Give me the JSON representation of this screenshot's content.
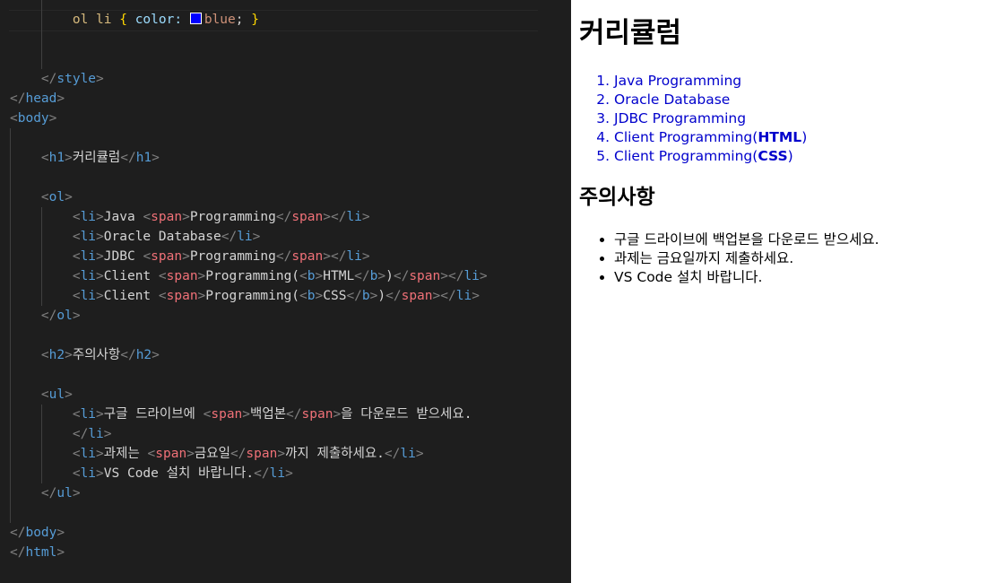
{
  "editor": {
    "lines": [
      [
        [
          "t-text",
          "        "
        ],
        [
          "t-sel",
          "ol li "
        ],
        [
          "t-brace",
          "{ "
        ],
        [
          "t-prop",
          "color: "
        ],
        [
          "swatch",
          ""
        ],
        [
          "t-val",
          "blue"
        ],
        [
          "t-text",
          "; "
        ],
        [
          "t-brace",
          "}"
        ]
      ],
      [],
      [],
      [
        [
          "t-text",
          "    "
        ],
        [
          "t-punc",
          "</"
        ],
        [
          "t-tag",
          "style"
        ],
        [
          "t-punc",
          ">"
        ]
      ],
      [
        [
          "t-punc",
          "</"
        ],
        [
          "t-tag",
          "head"
        ],
        [
          "t-punc",
          ">"
        ]
      ],
      [
        [
          "t-punc",
          "<"
        ],
        [
          "t-tag",
          "body"
        ],
        [
          "t-punc",
          ">"
        ]
      ],
      [],
      [
        [
          "t-text",
          "    "
        ],
        [
          "t-punc",
          "<"
        ],
        [
          "t-tag",
          "h1"
        ],
        [
          "t-punc",
          ">"
        ],
        [
          "t-text",
          "커리큘럼"
        ],
        [
          "t-punc",
          "</"
        ],
        [
          "t-tag",
          "h1"
        ],
        [
          "t-punc",
          ">"
        ]
      ],
      [],
      [
        [
          "t-text",
          "    "
        ],
        [
          "t-punc",
          "<"
        ],
        [
          "t-tag",
          "ol"
        ],
        [
          "t-punc",
          ">"
        ]
      ],
      [
        [
          "t-text",
          "        "
        ],
        [
          "t-punc",
          "<"
        ],
        [
          "t-tag",
          "li"
        ],
        [
          "t-punc",
          ">"
        ],
        [
          "t-text",
          "Java "
        ],
        [
          "t-punc",
          "<"
        ],
        [
          "t-tag2",
          "span"
        ],
        [
          "t-punc",
          ">"
        ],
        [
          "t-text",
          "Programming"
        ],
        [
          "t-punc",
          "</"
        ],
        [
          "t-tag2",
          "span"
        ],
        [
          "t-punc",
          "></"
        ],
        [
          "t-tag",
          "li"
        ],
        [
          "t-punc",
          ">"
        ]
      ],
      [
        [
          "t-text",
          "        "
        ],
        [
          "t-punc",
          "<"
        ],
        [
          "t-tag",
          "li"
        ],
        [
          "t-punc",
          ">"
        ],
        [
          "t-text",
          "Oracle Database"
        ],
        [
          "t-punc",
          "</"
        ],
        [
          "t-tag",
          "li"
        ],
        [
          "t-punc",
          ">"
        ]
      ],
      [
        [
          "t-text",
          "        "
        ],
        [
          "t-punc",
          "<"
        ],
        [
          "t-tag",
          "li"
        ],
        [
          "t-punc",
          ">"
        ],
        [
          "t-text",
          "JDBC "
        ],
        [
          "t-punc",
          "<"
        ],
        [
          "t-tag2",
          "span"
        ],
        [
          "t-punc",
          ">"
        ],
        [
          "t-text",
          "Programming"
        ],
        [
          "t-punc",
          "</"
        ],
        [
          "t-tag2",
          "span"
        ],
        [
          "t-punc",
          "></"
        ],
        [
          "t-tag",
          "li"
        ],
        [
          "t-punc",
          ">"
        ]
      ],
      [
        [
          "t-text",
          "        "
        ],
        [
          "t-punc",
          "<"
        ],
        [
          "t-tag",
          "li"
        ],
        [
          "t-punc",
          ">"
        ],
        [
          "t-text",
          "Client "
        ],
        [
          "t-punc",
          "<"
        ],
        [
          "t-tag2",
          "span"
        ],
        [
          "t-punc",
          ">"
        ],
        [
          "t-text",
          "Programming("
        ],
        [
          "t-punc",
          "<"
        ],
        [
          "t-tag",
          "b"
        ],
        [
          "t-punc",
          ">"
        ],
        [
          "t-text",
          "HTML"
        ],
        [
          "t-punc",
          "</"
        ],
        [
          "t-tag",
          "b"
        ],
        [
          "t-punc",
          ">"
        ],
        [
          "t-text",
          ")"
        ],
        [
          "t-punc",
          "</"
        ],
        [
          "t-tag2",
          "span"
        ],
        [
          "t-punc",
          "></"
        ],
        [
          "t-tag",
          "li"
        ],
        [
          "t-punc",
          ">"
        ]
      ],
      [
        [
          "t-text",
          "        "
        ],
        [
          "t-punc",
          "<"
        ],
        [
          "t-tag",
          "li"
        ],
        [
          "t-punc",
          ">"
        ],
        [
          "t-text",
          "Client "
        ],
        [
          "t-punc",
          "<"
        ],
        [
          "t-tag2",
          "span"
        ],
        [
          "t-punc",
          ">"
        ],
        [
          "t-text",
          "Programming("
        ],
        [
          "t-punc",
          "<"
        ],
        [
          "t-tag",
          "b"
        ],
        [
          "t-punc",
          ">"
        ],
        [
          "t-text",
          "CSS"
        ],
        [
          "t-punc",
          "</"
        ],
        [
          "t-tag",
          "b"
        ],
        [
          "t-punc",
          ">"
        ],
        [
          "t-text",
          ")"
        ],
        [
          "t-punc",
          "</"
        ],
        [
          "t-tag2",
          "span"
        ],
        [
          "t-punc",
          "></"
        ],
        [
          "t-tag",
          "li"
        ],
        [
          "t-punc",
          ">"
        ]
      ],
      [
        [
          "t-text",
          "    "
        ],
        [
          "t-punc",
          "</"
        ],
        [
          "t-tag",
          "ol"
        ],
        [
          "t-punc",
          ">"
        ]
      ],
      [],
      [
        [
          "t-text",
          "    "
        ],
        [
          "t-punc",
          "<"
        ],
        [
          "t-tag",
          "h2"
        ],
        [
          "t-punc",
          ">"
        ],
        [
          "t-text",
          "주의사항"
        ],
        [
          "t-punc",
          "</"
        ],
        [
          "t-tag",
          "h2"
        ],
        [
          "t-punc",
          ">"
        ]
      ],
      [],
      [
        [
          "t-text",
          "    "
        ],
        [
          "t-punc",
          "<"
        ],
        [
          "t-tag",
          "ul"
        ],
        [
          "t-punc",
          ">"
        ]
      ],
      [
        [
          "t-text",
          "        "
        ],
        [
          "t-punc",
          "<"
        ],
        [
          "t-tag",
          "li"
        ],
        [
          "t-punc",
          ">"
        ],
        [
          "t-text",
          "구글 드라이브에 "
        ],
        [
          "t-punc",
          "<"
        ],
        [
          "t-tag2",
          "span"
        ],
        [
          "t-punc",
          ">"
        ],
        [
          "t-text",
          "백업본"
        ],
        [
          "t-punc",
          "</"
        ],
        [
          "t-tag2",
          "span"
        ],
        [
          "t-punc",
          ">"
        ],
        [
          "t-text",
          "을 다운로드 받으세요."
        ]
      ],
      [
        [
          "t-text",
          "        "
        ],
        [
          "t-punc",
          "</"
        ],
        [
          "t-tag",
          "li"
        ],
        [
          "t-punc",
          ">"
        ]
      ],
      [
        [
          "t-text",
          "        "
        ],
        [
          "t-punc",
          "<"
        ],
        [
          "t-tag",
          "li"
        ],
        [
          "t-punc",
          ">"
        ],
        [
          "t-text",
          "과제는 "
        ],
        [
          "t-punc",
          "<"
        ],
        [
          "t-tag2",
          "span"
        ],
        [
          "t-punc",
          ">"
        ],
        [
          "t-text",
          "금요일"
        ],
        [
          "t-punc",
          "</"
        ],
        [
          "t-tag2",
          "span"
        ],
        [
          "t-punc",
          ">"
        ],
        [
          "t-text",
          "까지 제출하세요."
        ],
        [
          "t-punc",
          "</"
        ],
        [
          "t-tag",
          "li"
        ],
        [
          "t-punc",
          ">"
        ]
      ],
      [
        [
          "t-text",
          "        "
        ],
        [
          "t-punc",
          "<"
        ],
        [
          "t-tag",
          "li"
        ],
        [
          "t-punc",
          ">"
        ],
        [
          "t-text",
          "VS Code 설치 바랍니다."
        ],
        [
          "t-punc",
          "</"
        ],
        [
          "t-tag",
          "li"
        ],
        [
          "t-punc",
          ">"
        ]
      ],
      [
        [
          "t-text",
          "    "
        ],
        [
          "t-punc",
          "</"
        ],
        [
          "t-tag",
          "ul"
        ],
        [
          "t-punc",
          ">"
        ]
      ],
      [],
      [
        [
          "t-punc",
          "</"
        ],
        [
          "t-tag",
          "body"
        ],
        [
          "t-punc",
          ">"
        ]
      ],
      [
        [
          "t-punc",
          "</"
        ],
        [
          "t-tag",
          "html"
        ],
        [
          "t-punc",
          ">"
        ]
      ]
    ]
  },
  "preview": {
    "h1": "커리큘럼",
    "ol": [
      {
        "text": "Java Programming"
      },
      {
        "text": "Oracle Database"
      },
      {
        "text": "JDBC Programming"
      },
      {
        "pre": "Client Programming(",
        "b": "HTML",
        "post": ")"
      },
      {
        "pre": "Client Programming(",
        "b": "CSS",
        "post": ")"
      }
    ],
    "h2": "주의사항",
    "ul": [
      "구글 드라이브에 백업본을 다운로드 받으세요.",
      "과제는 금요일까지 제출하세요.",
      "VS Code 설치 바랍니다."
    ]
  }
}
